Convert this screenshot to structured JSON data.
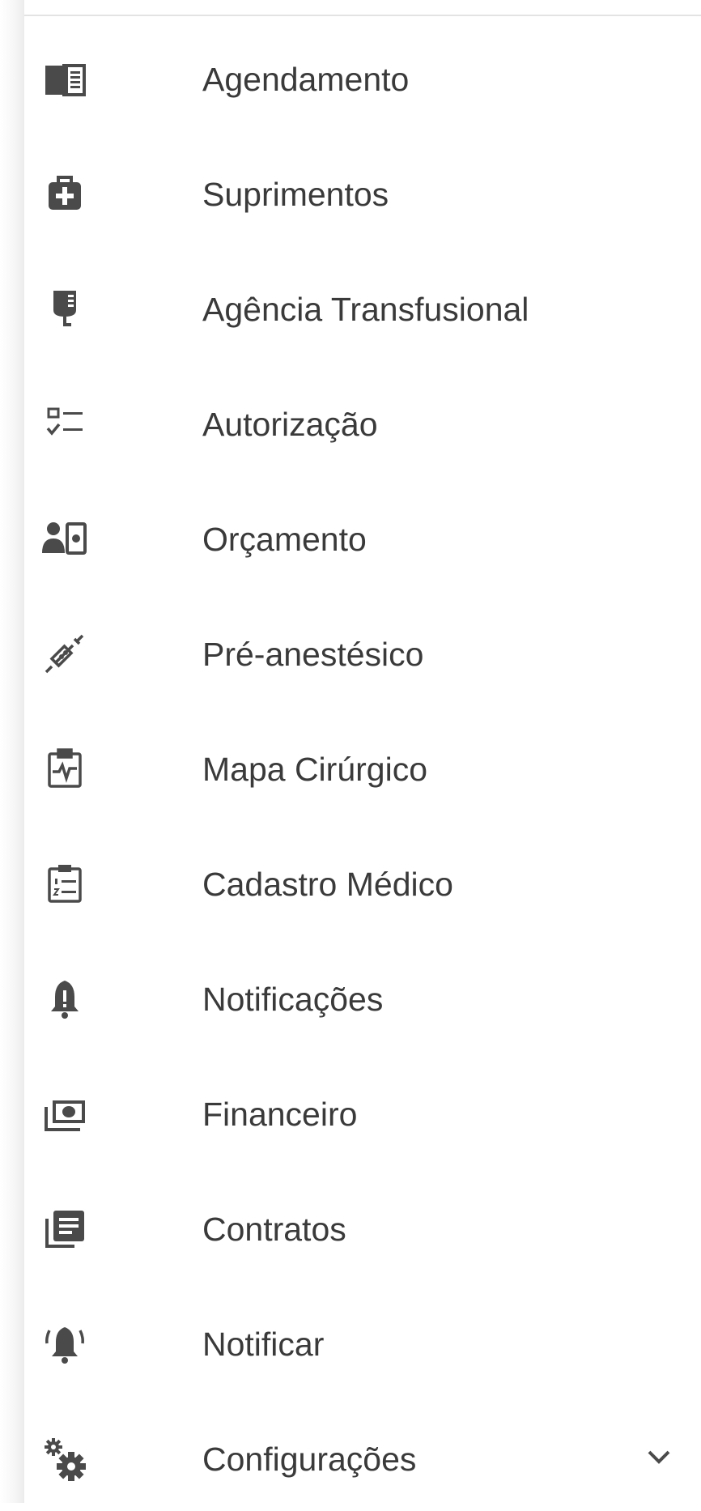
{
  "colors": {
    "icon": "#4a4a4a",
    "text": "#3a3a3a",
    "divider": "#e3e3e3"
  },
  "menu": {
    "items": [
      {
        "label": "Agendamento",
        "icon": "book-open-icon"
      },
      {
        "label": "Suprimentos",
        "icon": "medical-kit-icon"
      },
      {
        "label": "Agência Transfusional",
        "icon": "blood-bag-icon"
      },
      {
        "label": "Autorização",
        "icon": "checklist-icon"
      },
      {
        "label": "Orçamento",
        "icon": "person-cash-icon"
      },
      {
        "label": "Pré-anestésico",
        "icon": "syringe-icon"
      },
      {
        "label": "Mapa Cirúrgico",
        "icon": "clipboard-pulse-icon"
      },
      {
        "label": "Cadastro Médico",
        "icon": "clipboard-list-icon"
      },
      {
        "label": "Notificações",
        "icon": "bell-icon"
      },
      {
        "label": "Financeiro",
        "icon": "cash-stack-icon"
      },
      {
        "label": "Contratos",
        "icon": "document-stack-icon"
      },
      {
        "label": "Notificar",
        "icon": "bell-ring-icon"
      },
      {
        "label": "Configurações",
        "icon": "gears-icon",
        "expandable": true
      }
    ]
  }
}
